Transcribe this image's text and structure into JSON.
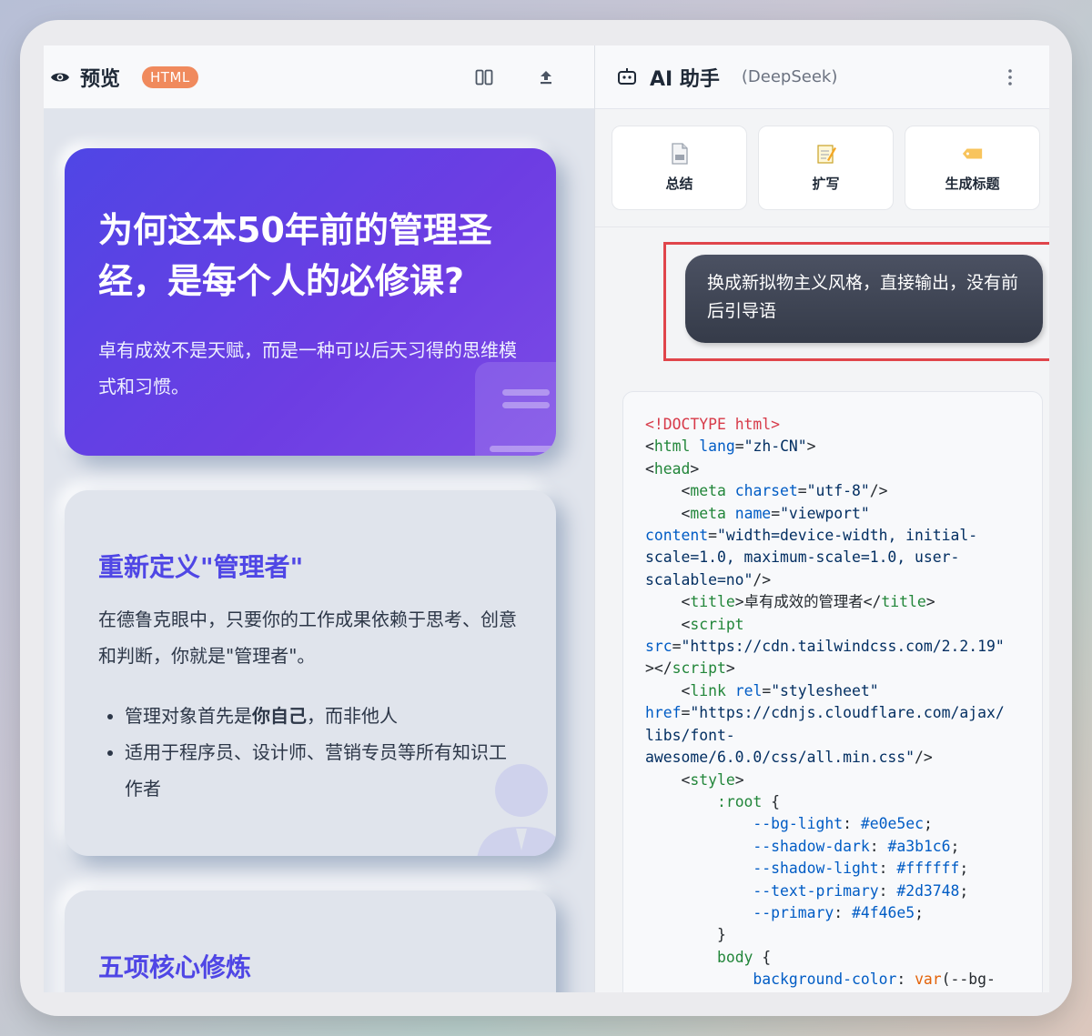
{
  "left": {
    "title": "预览",
    "badge": "HTML",
    "hero": {
      "title": "为何这本50年前的管理圣经，是每个人的必修课?",
      "subtitle": "卓有成效不是天赋，而是一种可以后天习得的思维模式和习惯。"
    },
    "card1": {
      "heading": "重新定义\"管理者\"",
      "desc": "在德鲁克眼中，只要你的工作成果依赖于思考、创意和判断，你就是\"管理者\"。",
      "bullet1_pre": "管理对象首先是",
      "bullet1_bold": "你自己",
      "bullet1_post": "，而非他人",
      "bullet2": "适用于程序员、设计师、营销专员等所有知识工作者"
    },
    "card2": {
      "heading": "五项核心修炼"
    }
  },
  "right": {
    "title": "AI 助手",
    "subtitle": "(DeepSeek)",
    "actions": [
      {
        "label": "总结",
        "icon": "document-icon"
      },
      {
        "label": "扩写",
        "icon": "memo-icon"
      },
      {
        "label": "生成标题",
        "icon": "label-icon"
      }
    ],
    "message": "换成新拟物主义风格，直接输出，没有前后引导语"
  },
  "colors": {
    "primary": "#4f46e5",
    "bg_light": "#e0e5ec",
    "badge": "#f08a5d",
    "highlight": "#e0454b"
  }
}
